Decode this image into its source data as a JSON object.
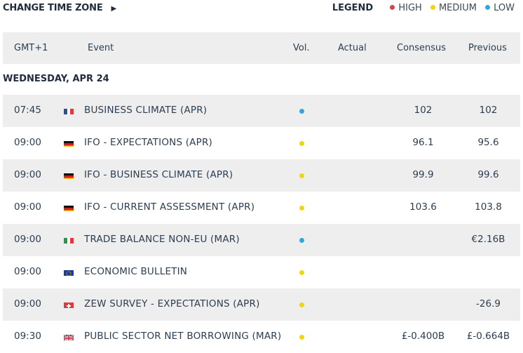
{
  "toolbar": {
    "change_tz_label": "CHANGE TIME ZONE"
  },
  "legend": {
    "title": "LEGEND",
    "items": [
      {
        "label": "HIGH",
        "color": "#d1454f"
      },
      {
        "label": "MEDIUM",
        "color": "#f2d40f"
      },
      {
        "label": "LOW",
        "color": "#2fa8e0"
      }
    ]
  },
  "table": {
    "headers": [
      "GMT+1",
      "Event",
      "Vol.",
      "Actual",
      "Consensus",
      "Previous"
    ],
    "date": "WEDNESDAY, APR 24",
    "rows": [
      {
        "time": "07:45",
        "flag": "fr-flag-icon",
        "event": "BUSINESS CLIMATE (APR)",
        "vol": "low",
        "actual": "",
        "consensus": "102",
        "previous": "102"
      },
      {
        "time": "09:00",
        "flag": "de-flag-icon",
        "event": "IFO - EXPECTATIONS (APR)",
        "vol": "medium",
        "actual": "",
        "consensus": "96.1",
        "previous": "95.6"
      },
      {
        "time": "09:00",
        "flag": "de-flag-icon",
        "event": "IFO - BUSINESS CLIMATE (APR)",
        "vol": "medium",
        "actual": "",
        "consensus": "99.9",
        "previous": "99.6"
      },
      {
        "time": "09:00",
        "flag": "de-flag-icon",
        "event": "IFO - CURRENT ASSESSMENT (APR)",
        "vol": "medium",
        "actual": "",
        "consensus": "103.6",
        "previous": "103.8"
      },
      {
        "time": "09:00",
        "flag": "it-flag-icon",
        "event": "TRADE BALANCE NON-EU (MAR)",
        "vol": "low",
        "actual": "",
        "consensus": "",
        "previous": "€2.16B"
      },
      {
        "time": "09:00",
        "flag": "eu-flag-icon",
        "event": "ECONOMIC BULLETIN",
        "vol": "medium",
        "actual": "",
        "consensus": "",
        "previous": ""
      },
      {
        "time": "09:00",
        "flag": "ch-flag-icon",
        "event": "ZEW SURVEY - EXPECTATIONS (APR)",
        "vol": "medium",
        "actual": "",
        "consensus": "",
        "previous": "-26.9"
      },
      {
        "time": "09:30",
        "flag": "gb-flag-icon",
        "event": "PUBLIC SECTOR NET BORROWING (MAR)",
        "vol": "medium",
        "actual": "",
        "consensus": "£-0.400B",
        "previous": "£-0.664B"
      }
    ]
  }
}
